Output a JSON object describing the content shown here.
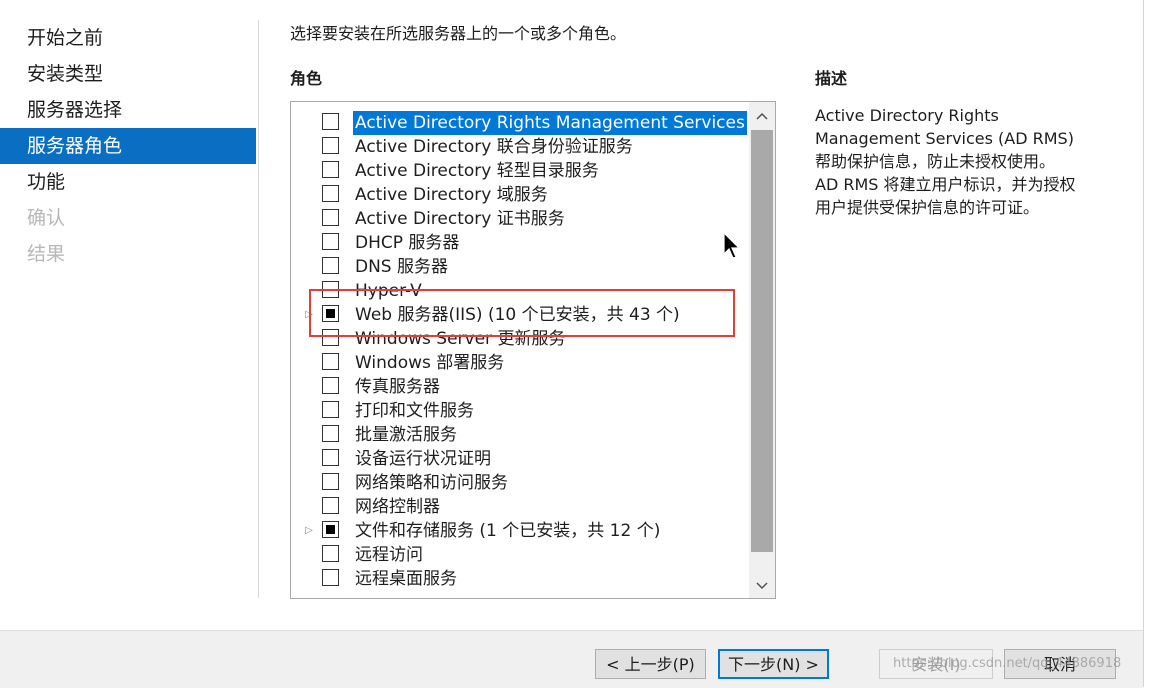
{
  "nav": {
    "items": [
      {
        "label": "开始之前"
      },
      {
        "label": "安装类型"
      },
      {
        "label": "服务器选择"
      },
      {
        "label": "服务器角色"
      },
      {
        "label": "功能"
      },
      {
        "label": "确认"
      },
      {
        "label": "结果"
      }
    ],
    "active": "服务器角色",
    "disabled": [
      "确认",
      "结果"
    ]
  },
  "main": {
    "instruction": "选择要安装在所选服务器上的一个或多个角色。",
    "roles_title": "角色",
    "description_title": "描述"
  },
  "roles": [
    {
      "label": "Active Directory Rights Management Services",
      "state": "unchecked",
      "selected": true,
      "expandable": false
    },
    {
      "label": "Active Directory 联合身份验证服务",
      "state": "unchecked",
      "selected": false,
      "expandable": false
    },
    {
      "label": "Active Directory 轻型目录服务",
      "state": "unchecked",
      "selected": false,
      "expandable": false
    },
    {
      "label": "Active Directory 域服务",
      "state": "unchecked",
      "selected": false,
      "expandable": false
    },
    {
      "label": "Active Directory 证书服务",
      "state": "unchecked",
      "selected": false,
      "expandable": false
    },
    {
      "label": "DHCP 服务器",
      "state": "unchecked",
      "selected": false,
      "expandable": false
    },
    {
      "label": "DNS 服务器",
      "state": "unchecked",
      "selected": false,
      "expandable": false
    },
    {
      "label": "Hyper-V",
      "state": "unchecked",
      "selected": false,
      "expandable": false
    },
    {
      "label": "Web 服务器(IIS) (10 个已安装，共 43 个)",
      "state": "partial",
      "selected": false,
      "expandable": true
    },
    {
      "label": "Windows Server 更新服务",
      "state": "unchecked",
      "selected": false,
      "expandable": false
    },
    {
      "label": "Windows 部署服务",
      "state": "unchecked",
      "selected": false,
      "expandable": false
    },
    {
      "label": "传真服务器",
      "state": "unchecked",
      "selected": false,
      "expandable": false
    },
    {
      "label": "打印和文件服务",
      "state": "unchecked",
      "selected": false,
      "expandable": false
    },
    {
      "label": "批量激活服务",
      "state": "unchecked",
      "selected": false,
      "expandable": false
    },
    {
      "label": "设备运行状况证明",
      "state": "unchecked",
      "selected": false,
      "expandable": false
    },
    {
      "label": "网络策略和访问服务",
      "state": "unchecked",
      "selected": false,
      "expandable": false
    },
    {
      "label": "网络控制器",
      "state": "unchecked",
      "selected": false,
      "expandable": false
    },
    {
      "label": "文件和存储服务 (1 个已安装，共 12 个)",
      "state": "partial",
      "selected": false,
      "expandable": true
    },
    {
      "label": "远程访问",
      "state": "unchecked",
      "selected": false,
      "expandable": false
    },
    {
      "label": "远程桌面服务",
      "state": "unchecked",
      "selected": false,
      "expandable": false
    }
  ],
  "description": {
    "lines": [
      "Active Directory Rights",
      "Management Services (AD RMS)",
      "帮助保护信息，防止未授权使用。",
      "AD RMS 将建立用户标识，并为授权",
      "用户提供受保护信息的许可证。"
    ]
  },
  "buttons": {
    "prev": "< 上一步(P)",
    "next": "下一步(N) >",
    "install": "安装(I)",
    "cancel": "取消"
  },
  "icons": {
    "expander": "expand-arrow-icon",
    "scroll_up": "chevron-up-icon",
    "scroll_down": "chevron-down-icon",
    "cursor": "mouse-pointer-icon"
  },
  "watermark": "https://blog.csdn.net/qq_44886918",
  "colors": {
    "nav_active_bg": "#0a6fc2",
    "selection_bg": "#0078d7",
    "highlight_border": "#e0403a"
  }
}
